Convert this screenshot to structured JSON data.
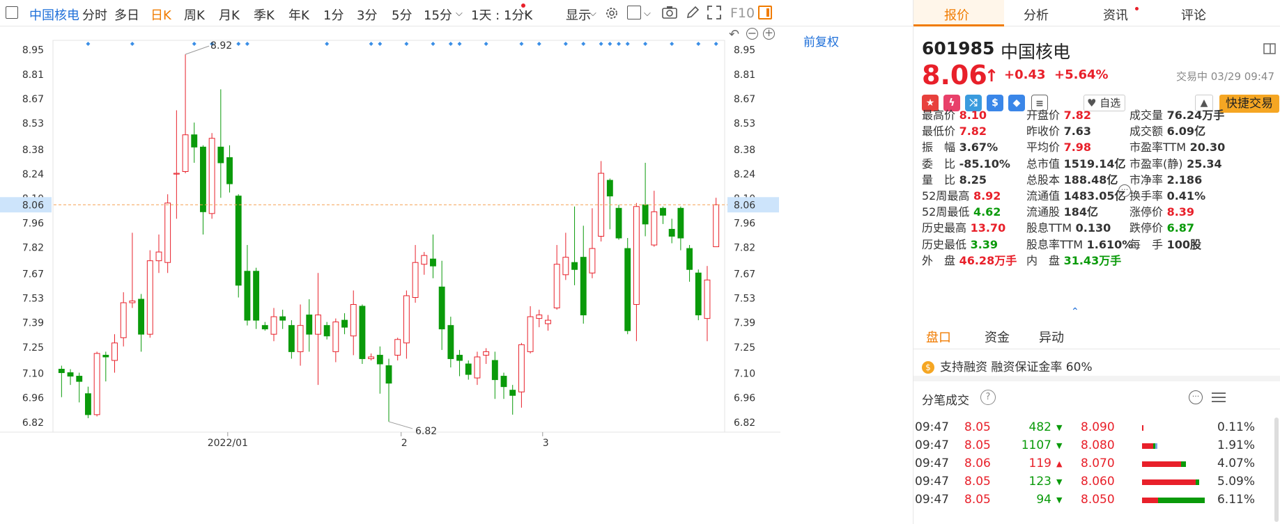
{
  "toolbar": {
    "stock_name": "中国核电",
    "periods": [
      "分时",
      "多日",
      "日K",
      "周K",
      "月K",
      "季K",
      "年K",
      "1分",
      "3分",
      "5分",
      "15分"
    ],
    "active_period": "日K",
    "multi_period": "1天 : 1分K",
    "display_label": "显示"
  },
  "chart": {
    "fq_label": "前复权",
    "right_f10": "F10",
    "y_ticks": [
      "8.95",
      "8.81",
      "8.67",
      "8.53",
      "8.38",
      "8.24",
      "8.10",
      "7.96",
      "7.82",
      "7.67",
      "7.53",
      "7.39",
      "7.25",
      "7.10",
      "6.96",
      "6.82"
    ],
    "current_price_label": "8.06",
    "high_label": "8.92",
    "low_label": "6.82",
    "x_labels": [
      "2022/01",
      "2",
      "3"
    ]
  },
  "chart_data": {
    "type": "candlestick",
    "ylim": [
      6.76,
      9.0
    ],
    "current_price": 8.06,
    "x_axis_labels": [
      "2022/01",
      "2",
      "3"
    ],
    "candles": [
      {
        "o": 7.12,
        "c": 7.1,
        "h": 7.14,
        "l": 6.96
      },
      {
        "o": 7.1,
        "c": 7.08,
        "h": 7.12,
        "l": 7.03
      },
      {
        "o": 7.08,
        "c": 7.05,
        "h": 7.1,
        "l": 6.93
      },
      {
        "o": 6.98,
        "c": 6.86,
        "h": 7.02,
        "l": 6.84
      },
      {
        "o": 6.86,
        "c": 7.21,
        "h": 7.22,
        "l": 6.85
      },
      {
        "o": 7.2,
        "c": 7.19,
        "h": 7.22,
        "l": 7.05
      },
      {
        "o": 7.17,
        "c": 7.27,
        "h": 7.32,
        "l": 7.1
      },
      {
        "o": 7.3,
        "c": 7.5,
        "h": 7.56,
        "l": 7.25
      },
      {
        "o": 7.5,
        "c": 7.51,
        "h": 7.9,
        "l": 7.47
      },
      {
        "o": 7.52,
        "c": 7.32,
        "h": 7.55,
        "l": 7.22
      },
      {
        "o": 7.32,
        "c": 7.74,
        "h": 7.8,
        "l": 7.3
      },
      {
        "o": 7.74,
        "c": 7.79,
        "h": 7.89,
        "l": 7.67
      },
      {
        "o": 7.73,
        "c": 8.07,
        "h": 8.12,
        "l": 7.67
      },
      {
        "o": 8.24,
        "c": 8.24,
        "h": 8.6,
        "l": 7.98
      },
      {
        "o": 8.25,
        "c": 8.46,
        "h": 8.92,
        "l": 8.24
      },
      {
        "o": 8.46,
        "c": 8.39,
        "h": 8.53,
        "l": 8.3
      },
      {
        "o": 8.39,
        "c": 8.02,
        "h": 8.4,
        "l": 7.89
      },
      {
        "o": 8.01,
        "c": 8.44,
        "h": 8.47,
        "l": 7.98
      },
      {
        "o": 8.39,
        "c": 8.3,
        "h": 8.72,
        "l": 8.1
      },
      {
        "o": 8.33,
        "c": 8.18,
        "h": 8.4,
        "l": 8.13
      },
      {
        "o": 8.11,
        "c": 7.6,
        "h": 8.12,
        "l": 7.53
      },
      {
        "o": 7.68,
        "c": 7.4,
        "h": 7.83,
        "l": 7.37
      },
      {
        "o": 7.68,
        "c": 7.4,
        "h": 7.7,
        "l": 7.35
      },
      {
        "o": 7.37,
        "c": 7.35,
        "h": 7.39,
        "l": 7.34
      },
      {
        "o": 7.32,
        "c": 7.42,
        "h": 7.47,
        "l": 7.28
      },
      {
        "o": 7.42,
        "c": 7.4,
        "h": 7.46,
        "l": 7.35
      },
      {
        "o": 7.37,
        "c": 7.22,
        "h": 7.4,
        "l": 7.18
      },
      {
        "o": 7.22,
        "c": 7.37,
        "h": 7.49,
        "l": 7.14
      },
      {
        "o": 7.43,
        "c": 7.32,
        "h": 7.52,
        "l": 7.22
      },
      {
        "o": 7.32,
        "c": 7.43,
        "h": 7.67,
        "l": 7.03
      },
      {
        "o": 7.37,
        "c": 7.31,
        "h": 7.39,
        "l": 7.29
      },
      {
        "o": 7.22,
        "c": 7.39,
        "h": 7.41,
        "l": 7.16
      },
      {
        "o": 7.4,
        "c": 7.36,
        "h": 7.44,
        "l": 7.32
      },
      {
        "o": 7.31,
        "c": 7.49,
        "h": 7.57,
        "l": 7.2
      },
      {
        "o": 7.48,
        "c": 7.18,
        "h": 7.49,
        "l": 7.15
      },
      {
        "o": 7.18,
        "c": 7.19,
        "h": 7.21,
        "l": 7.17
      },
      {
        "o": 7.2,
        "c": 7.15,
        "h": 7.25,
        "l": 6.98
      },
      {
        "o": 7.14,
        "c": 7.04,
        "h": 7.18,
        "l": 6.82
      },
      {
        "o": 7.2,
        "c": 7.29,
        "h": 7.3,
        "l": 7.17
      },
      {
        "o": 7.27,
        "c": 7.54,
        "h": 7.57,
        "l": 7.18
      },
      {
        "o": 7.53,
        "c": 7.73,
        "h": 7.83,
        "l": 7.5
      },
      {
        "o": 7.72,
        "c": 7.77,
        "h": 7.79,
        "l": 7.66
      },
      {
        "o": 7.75,
        "c": 7.71,
        "h": 7.89,
        "l": 7.64
      },
      {
        "o": 7.59,
        "c": 7.35,
        "h": 7.74,
        "l": 7.23
      },
      {
        "o": 7.37,
        "c": 7.18,
        "h": 7.42,
        "l": 7.13
      },
      {
        "o": 7.2,
        "c": 7.17,
        "h": 7.23,
        "l": 7.08
      },
      {
        "o": 7.15,
        "c": 7.09,
        "h": 7.17,
        "l": 7.06
      },
      {
        "o": 7.07,
        "c": 7.19,
        "h": 7.22,
        "l": 7.03
      },
      {
        "o": 7.2,
        "c": 7.22,
        "h": 7.24,
        "l": 7.15
      },
      {
        "o": 7.17,
        "c": 7.06,
        "h": 7.22,
        "l": 6.95
      },
      {
        "o": 7.08,
        "c": 7.02,
        "h": 7.1,
        "l": 6.95
      },
      {
        "o": 7.0,
        "c": 6.97,
        "h": 7.03,
        "l": 6.86
      },
      {
        "o": 6.99,
        "c": 7.26,
        "h": 7.27,
        "l": 6.9
      },
      {
        "o": 7.22,
        "c": 7.42,
        "h": 7.48,
        "l": 7.21
      },
      {
        "o": 7.41,
        "c": 7.43,
        "h": 7.46,
        "l": 7.36
      },
      {
        "o": 7.38,
        "c": 7.4,
        "h": 7.43,
        "l": 7.34
      },
      {
        "o": 7.47,
        "c": 7.72,
        "h": 7.83,
        "l": 7.46
      },
      {
        "o": 7.66,
        "c": 7.76,
        "h": 7.9,
        "l": 7.63
      },
      {
        "o": 7.73,
        "c": 7.69,
        "h": 8.05,
        "l": 7.6
      },
      {
        "o": 7.76,
        "c": 7.43,
        "h": 7.94,
        "l": 7.38
      },
      {
        "o": 7.67,
        "c": 7.81,
        "h": 8.04,
        "l": 7.64
      },
      {
        "o": 7.88,
        "c": 8.24,
        "h": 8.31,
        "l": 7.85
      },
      {
        "o": 8.2,
        "c": 8.11,
        "h": 8.21,
        "l": 7.92
      },
      {
        "o": 8.04,
        "c": 7.87,
        "h": 8.06,
        "l": 7.86
      },
      {
        "o": 7.81,
        "c": 7.34,
        "h": 7.87,
        "l": 7.32
      },
      {
        "o": 7.49,
        "c": 8.05,
        "h": 8.07,
        "l": 7.28
      },
      {
        "o": 8.06,
        "c": 7.95,
        "h": 8.3,
        "l": 7.88
      },
      {
        "o": 7.83,
        "c": 8.02,
        "h": 8.14,
        "l": 7.82
      },
      {
        "o": 8.04,
        "c": 8.0,
        "h": 8.05,
        "l": 7.95
      },
      {
        "o": 7.92,
        "c": 7.88,
        "h": 7.98,
        "l": 7.84
      },
      {
        "o": 8.04,
        "c": 7.87,
        "h": 8.05,
        "l": 7.8
      },
      {
        "o": 7.81,
        "c": 7.69,
        "h": 7.83,
        "l": 7.62
      },
      {
        "o": 7.67,
        "c": 7.43,
        "h": 7.69,
        "l": 7.4
      },
      {
        "o": 7.41,
        "c": 7.63,
        "h": 7.71,
        "l": 7.28
      },
      {
        "o": 7.82,
        "c": 8.06,
        "h": 8.1,
        "l": 7.82
      }
    ]
  },
  "right": {
    "tabs": [
      "报价",
      "分析",
      "资讯",
      "评论"
    ],
    "active_tab": "报价",
    "code": "601985",
    "name": "中国核电",
    "price": "8.06",
    "arrow": "↑",
    "change": "+0.43",
    "change_pct": "+5.64%",
    "status": "交易中 03/29 09:47",
    "watch_label": "自选",
    "quick_trade": "快捷交易",
    "quote_rows": [
      [
        [
          "最高价",
          "8.10",
          "red"
        ],
        [
          "开盘价",
          "7.82",
          "red"
        ],
        [
          "成交量",
          "76.24万手",
          ""
        ]
      ],
      [
        [
          "最低价",
          "7.82",
          "red"
        ],
        [
          "昨收价",
          "7.63",
          ""
        ],
        [
          "成交额",
          "6.09亿",
          ""
        ]
      ],
      [
        [
          "振　幅",
          "3.67%",
          ""
        ],
        [
          "平均价",
          "7.98",
          "red"
        ],
        [
          "市盈率TTM",
          "20.30",
          ""
        ]
      ],
      [
        [
          "委　比",
          "-85.10%",
          ""
        ],
        [
          "总市值",
          "1519.14亿",
          ""
        ],
        [
          "市盈率(静)",
          "25.34",
          ""
        ]
      ],
      [
        [
          "量　比",
          "8.25",
          ""
        ],
        [
          "总股本",
          "188.48亿",
          ""
        ],
        [
          "市净率",
          "2.186",
          ""
        ]
      ],
      [
        [
          "52周最高",
          "8.92",
          "red"
        ],
        [
          "流通值",
          "1483.05亿",
          ""
        ],
        [
          "换手率",
          "0.41%",
          ""
        ]
      ],
      [
        [
          "52周最低",
          "4.62",
          "grn"
        ],
        [
          "流通股",
          "184亿",
          ""
        ],
        [
          "涨停价",
          "8.39",
          "red"
        ]
      ],
      [
        [
          "历史最高",
          "13.70",
          "red"
        ],
        [
          "股息TTM",
          "0.130",
          ""
        ],
        [
          "跌停价",
          "6.87",
          "grn"
        ]
      ],
      [
        [
          "历史最低",
          "3.39",
          "grn"
        ],
        [
          "股息率TTM",
          "1.610%",
          ""
        ],
        [
          "每　手",
          "100股",
          ""
        ]
      ],
      [
        [
          "外　盘",
          "46.28万手",
          "red"
        ],
        [
          "内　盘",
          "31.43万手",
          "grn"
        ],
        [
          "",
          "",
          ""
        ]
      ]
    ],
    "subtabs": [
      "盘口",
      "资金",
      "异动"
    ],
    "margin_text": "支持融资 融资保证金率 60%",
    "split_title": "分笔成交",
    "trades": [
      {
        "time": "09:47",
        "price": "8.05",
        "vol": "482",
        "dir": "down"
      },
      {
        "time": "09:47",
        "price": "8.05",
        "vol": "1107",
        "dir": "down"
      },
      {
        "time": "09:47",
        "price": "8.06",
        "vol": "119",
        "dir": "up"
      },
      {
        "time": "09:47",
        "price": "8.05",
        "vol": "123",
        "dir": "down"
      },
      {
        "time": "09:47",
        "price": "8.05",
        "vol": "94",
        "dir": "down"
      }
    ],
    "levels": [
      {
        "price": "8.090",
        "pct": "0.11%",
        "red": 0.01,
        "grn": 0.0,
        "blu": 0.0
      },
      {
        "price": "8.080",
        "pct": "1.91%",
        "red": 0.18,
        "grn": 0.03,
        "blu": 0.04
      },
      {
        "price": "8.070",
        "pct": "4.07%",
        "red": 0.62,
        "grn": 0.08,
        "blu": 0.0
      },
      {
        "price": "8.060",
        "pct": "5.09%",
        "red": 0.85,
        "grn": 0.06,
        "blu": 0.0
      },
      {
        "price": "8.050",
        "pct": "6.11%",
        "red": 0.25,
        "grn": 0.75,
        "blu": 0.0
      }
    ]
  },
  "colors": {
    "up": "#e8202a",
    "down": "#0a9a0a",
    "accent": "#f07b00",
    "blue": "#1e6fd9"
  }
}
